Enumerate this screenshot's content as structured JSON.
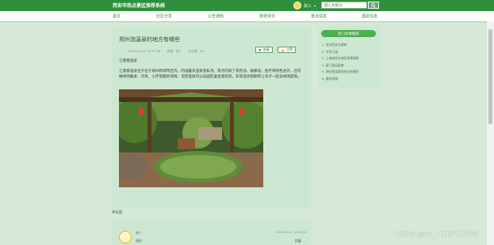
{
  "header": {
    "site_title": "西安市热点景区推荐系统",
    "username": "张三",
    "search_placeholder": "输入关键词",
    "search_icon": "search-icon"
  },
  "nav": [
    "首页",
    "社区分享",
    "公告通知",
    "旅游资讯",
    "景点信息",
    "酒店信息"
  ],
  "article": {
    "title": "郑州泡温泉的地方有哪些",
    "meta": [
      "2024-03-01 12:31:28",
      "作者：张三",
      "点击量：81"
    ],
    "collect_label": "收藏",
    "like_label": "点赞",
    "heading": "江南春温泉",
    "body": "江南春温泉位于位于郑州新郑市区内，内设露天温泉及私汤，景点内除了有药池、按摩池、鱼疗等特色池外，还可做休闲桑拿、汗蒸，小疗等服务项目。泡完温泉可以去园区里溜溜逛逛，非常适合假期带上亲子一起去休闲度假。"
  },
  "comments": {
    "label": "评论区",
    "items": [
      {
        "name": "张三",
        "text": "很好",
        "time": "2024-03-01 12:24:24",
        "reply": "回复"
      }
    ]
  },
  "sidebar": {
    "title": "热门文章推荐",
    "items": [
      "1. 寻访西安古建筑",
      "2. 冬季之旅",
      "3. 上海体验东南亚美食探秘",
      "4. 厦门游玩指南",
      "5. 郑州泡温泉的地方有哪些",
      "6. 重庆攻略"
    ]
  },
  "watermark": "CSDN @vx_CXKF10088"
}
